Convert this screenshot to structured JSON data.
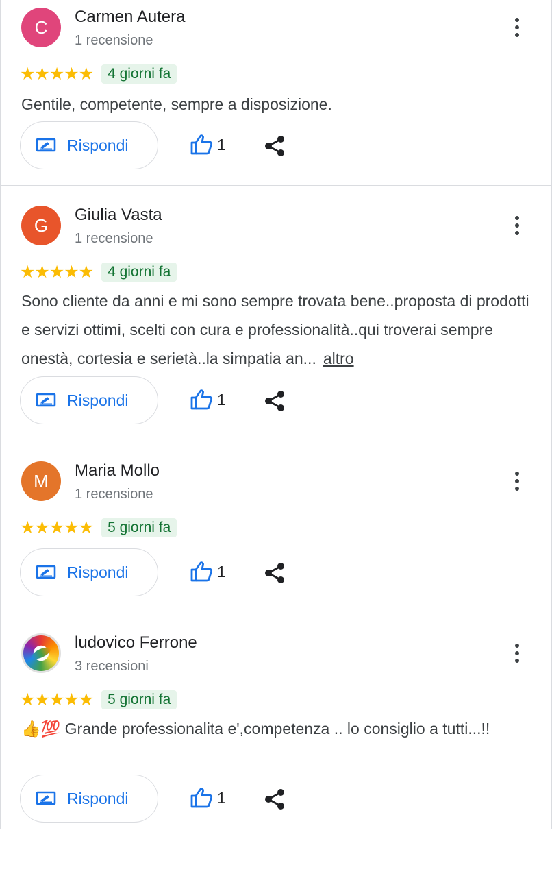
{
  "reviews": [
    {
      "avatar_letter": "C",
      "avatar_color": "#e0457b",
      "name": "Carmen Autera",
      "count": "1 recensione",
      "stars": "★★★★★",
      "date": "4 giorni fa",
      "text": "Gentile, competente, sempre a disposizione.",
      "reply_label": "Rispondi",
      "likes": "1"
    },
    {
      "avatar_letter": "G",
      "avatar_color": "#e8552b",
      "name": "Giulia Vasta",
      "count": "1 recensione",
      "stars": "★★★★★",
      "date": "4 giorni fa",
      "text": "Sono cliente da anni e mi sono sempre trovata bene..proposta di prodotti e servizi ottimi, scelti con cura e professionalità..qui troverai sempre onestà, cortesia e serietà..la simpatia an...",
      "more_label": "altro",
      "reply_label": "Rispondi",
      "likes": "1"
    },
    {
      "avatar_letter": "M",
      "avatar_color": "#e4752a",
      "name": "Maria Mollo",
      "count": "1 recensione",
      "stars": "★★★★★",
      "date": "5 giorni fa",
      "reply_label": "Rispondi",
      "likes": "1"
    },
    {
      "name": "ludovico Ferrone",
      "count": "3 recensioni",
      "stars": "★★★★★",
      "date": "5 giorni fa",
      "text": "👍💯 Grande professionalita e',competenza .. lo consiglio a tutti...!!",
      "reply_label": "Rispondi",
      "likes": "1"
    }
  ],
  "icons": {
    "more": "more-vert-icon",
    "reply": "reply-edit-icon",
    "like": "thumb-up-icon",
    "share": "share-icon"
  },
  "colors": {
    "accent": "#1a73e8",
    "star": "#fbbc04",
    "date_bg": "#e6f4ea",
    "date_text": "#137333"
  }
}
